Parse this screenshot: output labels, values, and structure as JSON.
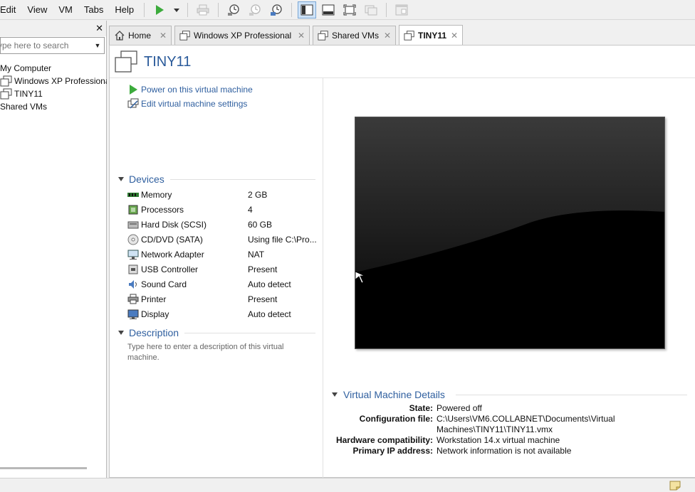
{
  "menu": {
    "items": [
      "Edit",
      "View",
      "VM",
      "Tabs",
      "Help"
    ]
  },
  "toolbar": {
    "buttons": [
      "play-icon",
      "dropdown-arrow-icon",
      "print-icon",
      "snapshot-icon",
      "revert-snapshot-icon",
      "manage-snapshots-icon",
      "library-view-icon",
      "thumbnail-bar-icon",
      "full-screen-icon",
      "unity-icon",
      "console-view-icon"
    ]
  },
  "library": {
    "search_placeholder": "ype here to search",
    "tree": [
      {
        "label": "My Computer",
        "icon": "computer-icon"
      },
      {
        "label": "Windows XP Professiona",
        "icon": "vm-icon"
      },
      {
        "label": "TINY11",
        "icon": "vm-icon"
      },
      {
        "label": "Shared VMs",
        "icon": "shared-vms-icon"
      }
    ]
  },
  "tabs": [
    {
      "label": "Home",
      "icon": "home-icon",
      "active": false
    },
    {
      "label": "Windows XP Professional",
      "icon": "vm-icon",
      "active": false
    },
    {
      "label": "Shared VMs",
      "icon": "shared-vms-icon",
      "active": false
    },
    {
      "label": "TINY11",
      "icon": "vm-icon",
      "active": true
    }
  ],
  "vm": {
    "name": "TINY11",
    "actions": {
      "power_on": "Power on this virtual machine",
      "edit_settings": "Edit virtual machine settings"
    },
    "devices_heading": "Devices",
    "devices": [
      {
        "name": "Memory",
        "value": "2 GB",
        "icon": "memory-icon"
      },
      {
        "name": "Processors",
        "value": "4",
        "icon": "processor-icon"
      },
      {
        "name": "Hard Disk (SCSI)",
        "value": "60 GB",
        "icon": "hard-disk-icon"
      },
      {
        "name": "CD/DVD (SATA)",
        "value": "Using file C:\\Pro...",
        "icon": "cd-dvd-icon"
      },
      {
        "name": "Network Adapter",
        "value": "NAT",
        "icon": "network-adapter-icon"
      },
      {
        "name": "USB Controller",
        "value": "Present",
        "icon": "usb-icon"
      },
      {
        "name": "Sound Card",
        "value": "Auto detect",
        "icon": "sound-card-icon"
      },
      {
        "name": "Printer",
        "value": "Present",
        "icon": "printer-icon"
      },
      {
        "name": "Display",
        "value": "Auto detect",
        "icon": "display-icon"
      }
    ],
    "description_heading": "Description",
    "description_placeholder": "Type here to enter a description of this virtual machine.",
    "details_heading": "Virtual Machine Details",
    "details": [
      {
        "key": "State:",
        "value": "Powered off"
      },
      {
        "key": "Configuration file:",
        "value": "C:\\Users\\VM6.COLLABNET\\Documents\\Virtual Machines\\TINY11\\TINY11.vmx"
      },
      {
        "key": "Hardware compatibility:",
        "value": "Workstation 14.x virtual machine"
      },
      {
        "key": "Primary IP address:",
        "value": "Network information is not available"
      }
    ]
  },
  "colors": {
    "accent": "#2f5f9f",
    "title": "#2a5a9a",
    "play": "#3cab3c"
  }
}
